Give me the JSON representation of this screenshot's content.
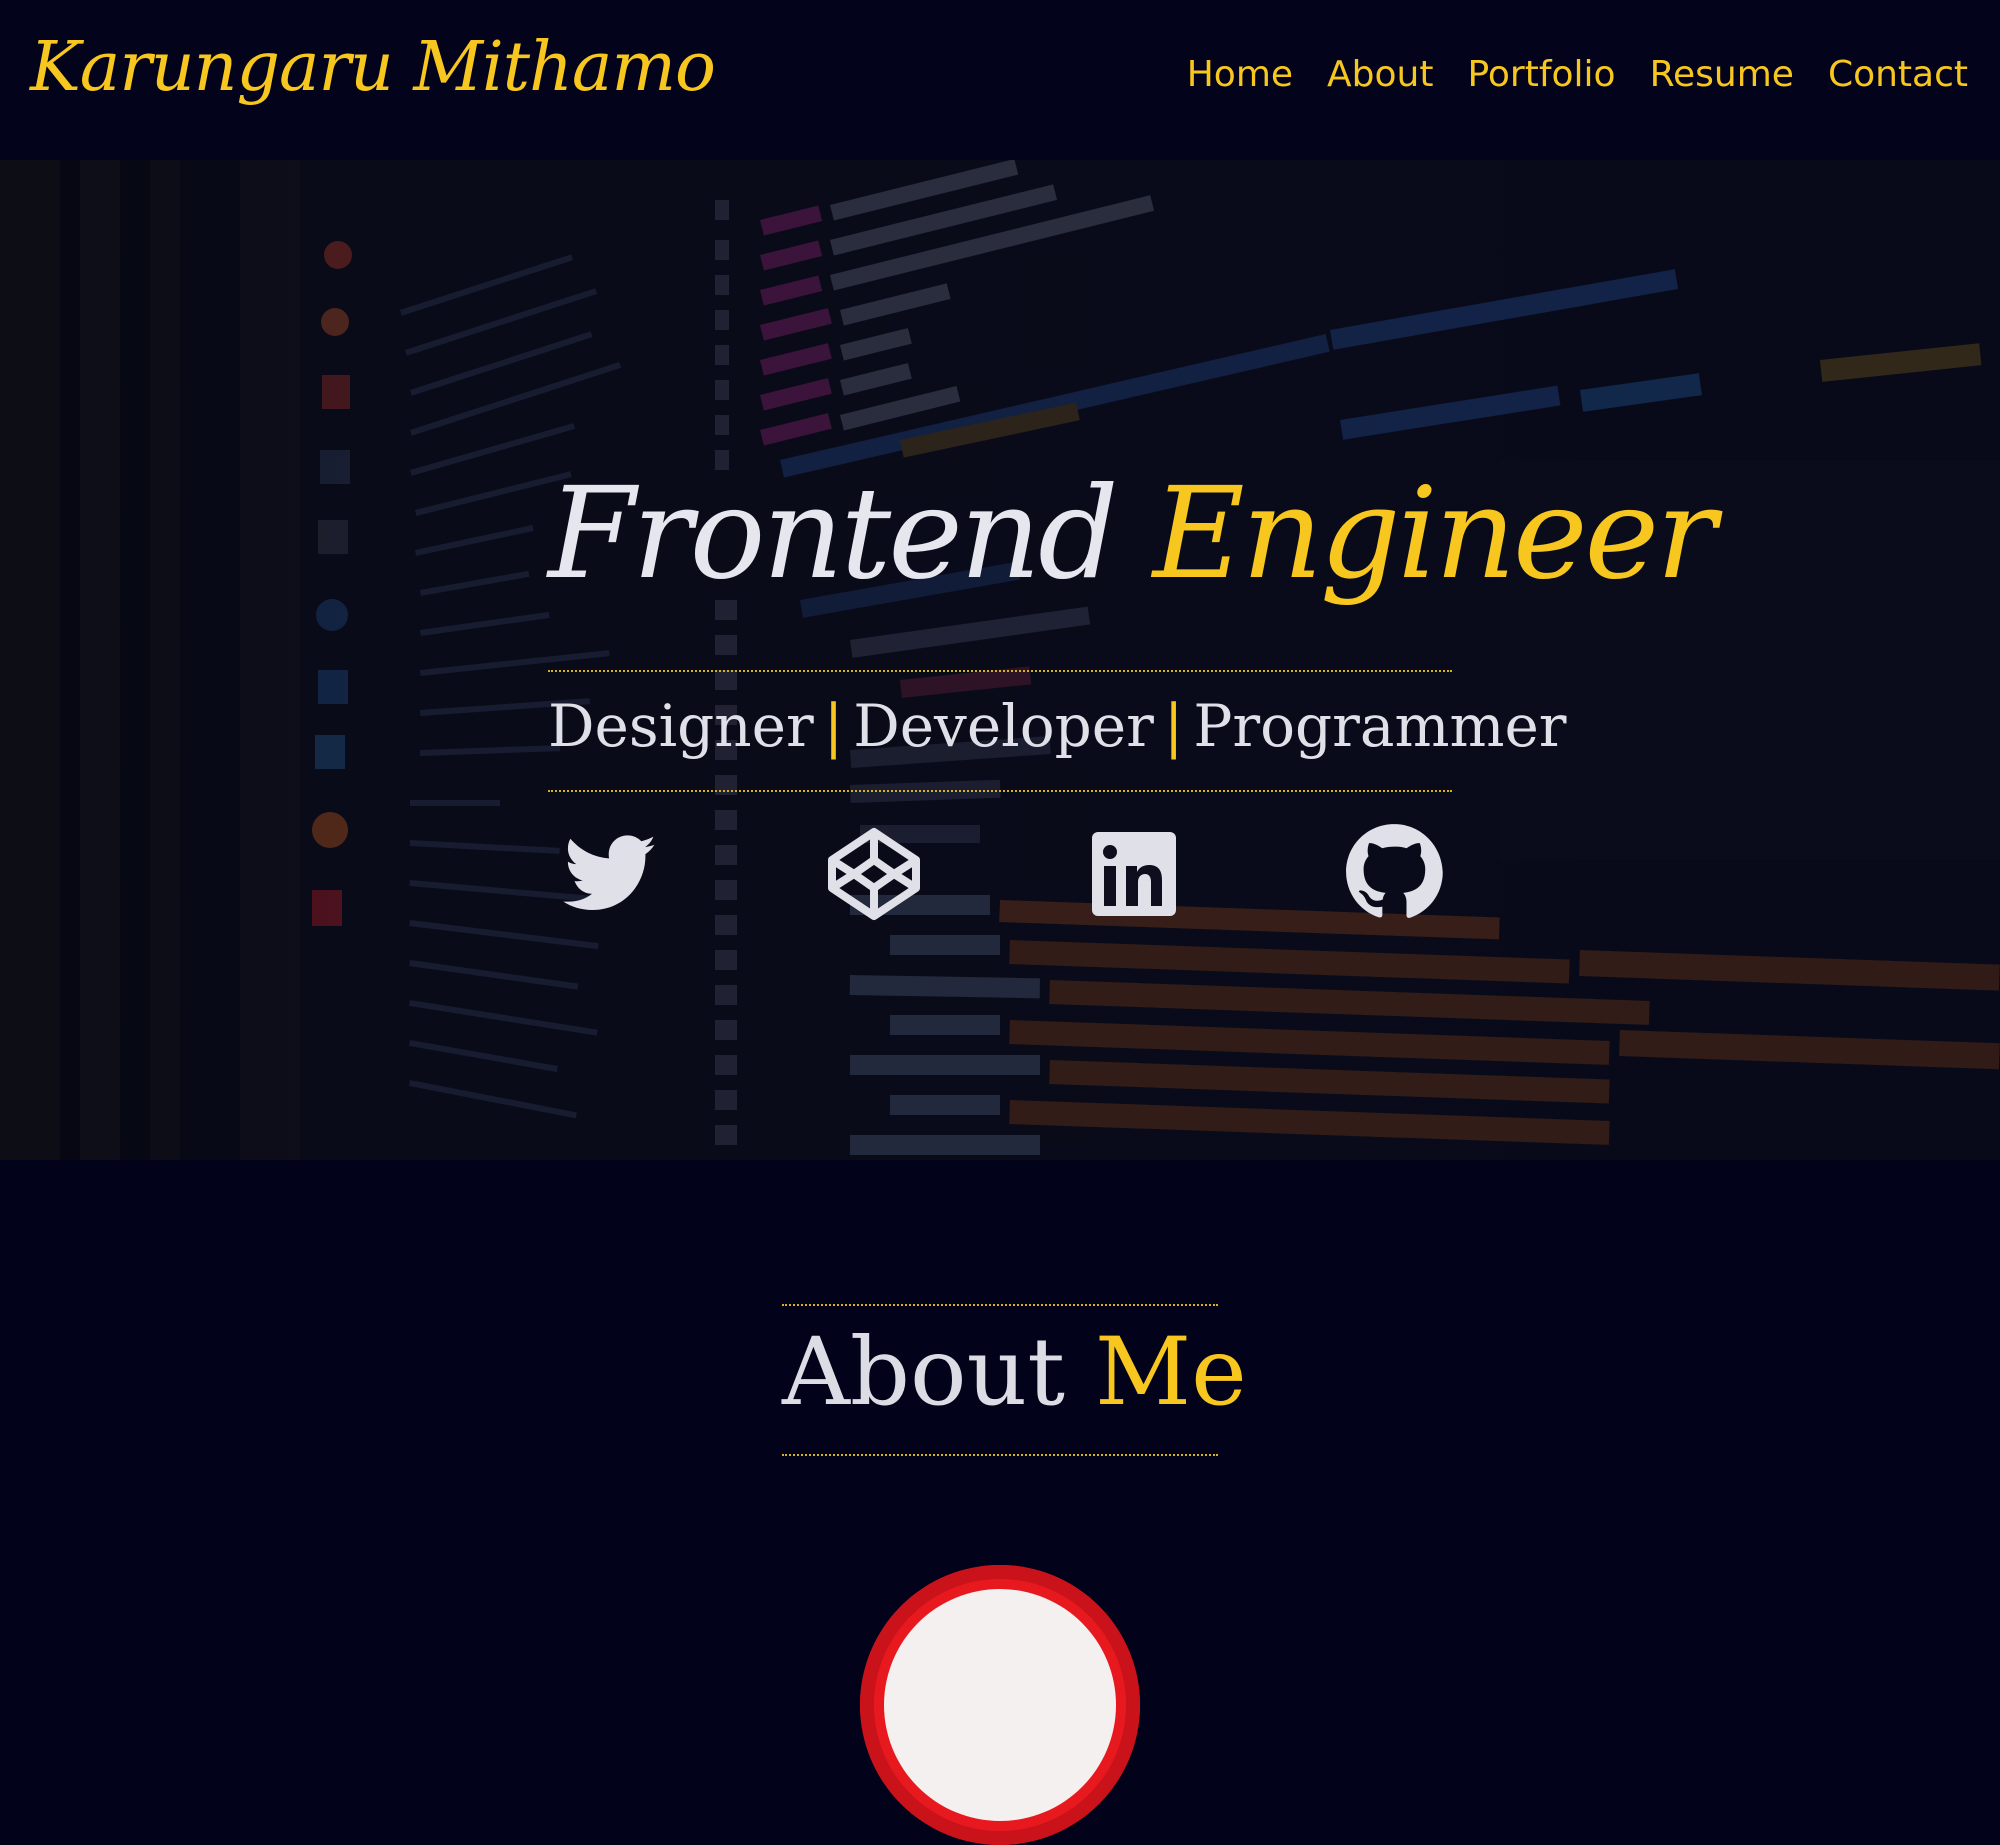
{
  "nav": {
    "brand": "Karungaru Mithamo",
    "links": [
      "Home",
      "About",
      "Portfolio",
      "Resume",
      "Contact"
    ]
  },
  "hero": {
    "title_part1": "Frontend",
    "title_part2": "Engineer",
    "roles": [
      "Designer",
      "Developer",
      "Programmer"
    ],
    "separator": "|",
    "social": [
      "twitter-icon",
      "codepen-icon",
      "linkedin-icon",
      "github-icon"
    ]
  },
  "about": {
    "title_part1": "About",
    "title_part2": "Me"
  },
  "colors": {
    "accent": "#f7c71f",
    "background": "#02031a",
    "text_light": "#e6e6ee",
    "avatar_ring": "#e8191e"
  }
}
